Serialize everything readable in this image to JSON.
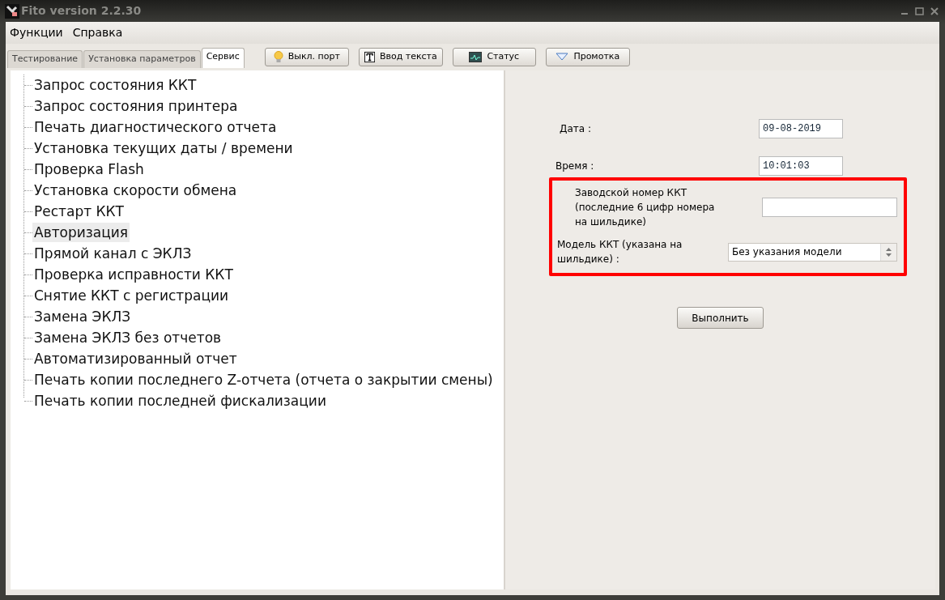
{
  "window": {
    "title": "Fito version 2.2.30"
  },
  "menu": [
    "Функции",
    "Справка"
  ],
  "tabs": [
    {
      "label": "Тестирование",
      "selected": false
    },
    {
      "label": "Установка параметров",
      "selected": false
    },
    {
      "label": "Сервис",
      "selected": true
    }
  ],
  "toolbar": [
    {
      "label": "Выкл. порт",
      "kind": "bulb"
    },
    {
      "label": "Ввод текста",
      "kind": "text"
    },
    {
      "label": "Статус",
      "kind": "monitor"
    },
    {
      "label": "Промотка",
      "kind": "triangle"
    }
  ],
  "tree": [
    {
      "label": "Запрос состояния ККТ",
      "selected": false
    },
    {
      "label": "Запрос состояния принтера",
      "selected": false
    },
    {
      "label": "Печать диагностического отчета",
      "selected": false
    },
    {
      "label": "Установка текущих даты / времени",
      "selected": false
    },
    {
      "label": "Проверка Flash",
      "selected": false
    },
    {
      "label": "Установка скорости обмена",
      "selected": false
    },
    {
      "label": "Рестарт ККТ",
      "selected": false
    },
    {
      "label": "Авторизация",
      "selected": true
    },
    {
      "label": "Прямой канал с ЭКЛЗ",
      "selected": false
    },
    {
      "label": "Проверка исправности ККТ",
      "selected": false
    },
    {
      "label": "Снятие ККТ с регистрации",
      "selected": false
    },
    {
      "label": "Замена ЭКЛЗ",
      "selected": false
    },
    {
      "label": "Замена ЭКЛЗ без отчетов",
      "selected": false
    },
    {
      "label": "Автоматизированный отчет",
      "selected": false
    },
    {
      "label": "Печать копии последнего Z-отчета (отчета о закрытии смены)",
      "selected": false
    },
    {
      "label": "Печать копии последней фискализации",
      "selected": false
    }
  ],
  "form": {
    "date": {
      "label": "Дата :",
      "value": "09-08-2019"
    },
    "time": {
      "label": "Время :",
      "value": "10:01:03"
    },
    "serial": {
      "label": "Заводской номер ККТ (последние 6 цифр номера на шильдике)"
    },
    "model": {
      "label": "Модель ККТ (указана на шильдике)  :",
      "value": "Без указания модели"
    },
    "button": "Выполнить"
  }
}
